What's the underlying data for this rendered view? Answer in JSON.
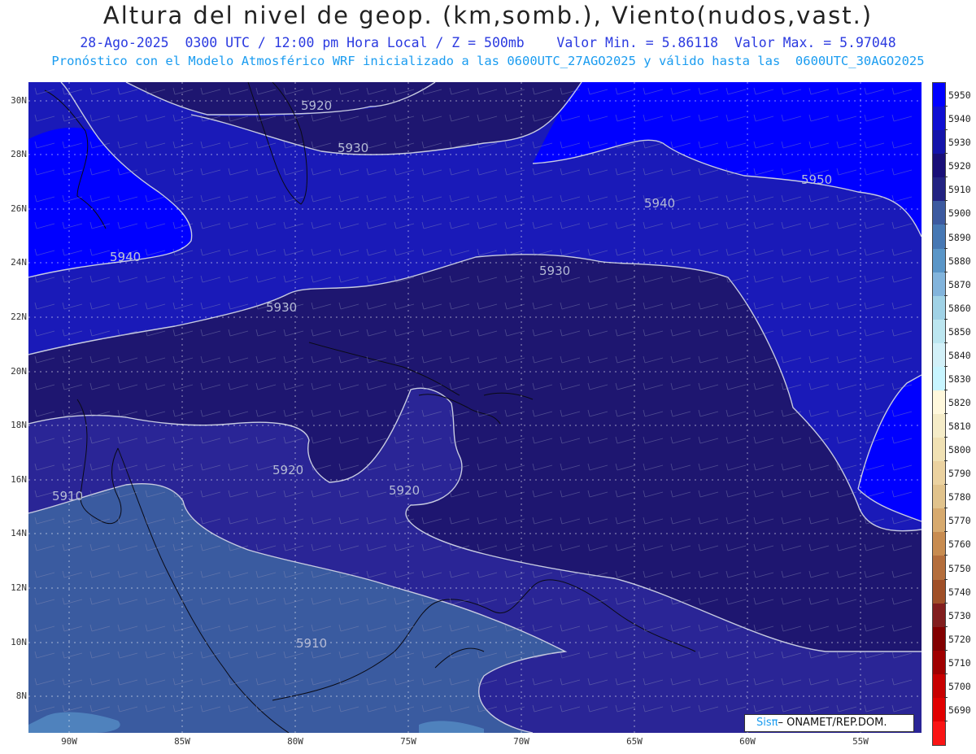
{
  "header": {
    "title": "Altura del nivel de geop. (km,somb.), Viento(nudos,vast.)",
    "subtitle1": "28-Ago-2025  0300 UTC / 12:00 pm Hora Local / Z = 500mb    Valor Min. = 5.86118  Valor Max. = 5.97048",
    "subtitle2": "Pronóstico con el Modelo Atmosférico WRF inicializado a las 0600UTC_27AGO2025 y válido hasta las  0600UTC_30AGO2025"
  },
  "map": {
    "lat_labels": [
      "30N",
      "28N",
      "26N",
      "24N",
      "22N",
      "20N",
      "18N",
      "16N",
      "14N",
      "12N",
      "10N",
      "8N"
    ],
    "lon_labels": [
      "90W",
      "85W",
      "80W",
      "75W",
      "70W",
      "65W",
      "60W",
      "55W"
    ],
    "contour_labels": [
      "5920",
      "5930",
      "5940",
      "5950",
      "5940",
      "5940",
      "5930",
      "5930",
      "5920",
      "5920",
      "5910",
      "5910"
    ],
    "credit_sis": "Sisπ",
    "credit_org": "– ONAMET/REP.DOM."
  },
  "colorbar": {
    "labels": [
      "5950",
      "5940",
      "5930",
      "5920",
      "5910",
      "5900",
      "5890",
      "5880",
      "5870",
      "5860",
      "5850",
      "5840",
      "5830",
      "5820",
      "5810",
      "5800",
      "5790",
      "5780",
      "5770",
      "5760",
      "5750",
      "5740",
      "5730",
      "5720",
      "5710",
      "5700",
      "5690"
    ],
    "colors": [
      "#0000ff",
      "#0f0fd2",
      "#1414aa",
      "#190f78",
      "#232382",
      "#3c5aa0",
      "#4678b4",
      "#5a96c8",
      "#82b4dc",
      "#a0d2e6",
      "#bce6f0",
      "#d2f0f8",
      "#c8f5ff",
      "#fff8dc",
      "#f5ecc8",
      "#f0e1b4",
      "#ebd2a0",
      "#e1c38c",
      "#d7aa6e",
      "#c88c50",
      "#b46e3c",
      "#a05028",
      "#821e1e",
      "#820000",
      "#a00000",
      "#c80000",
      "#e10000",
      "#fa1414"
    ]
  }
}
